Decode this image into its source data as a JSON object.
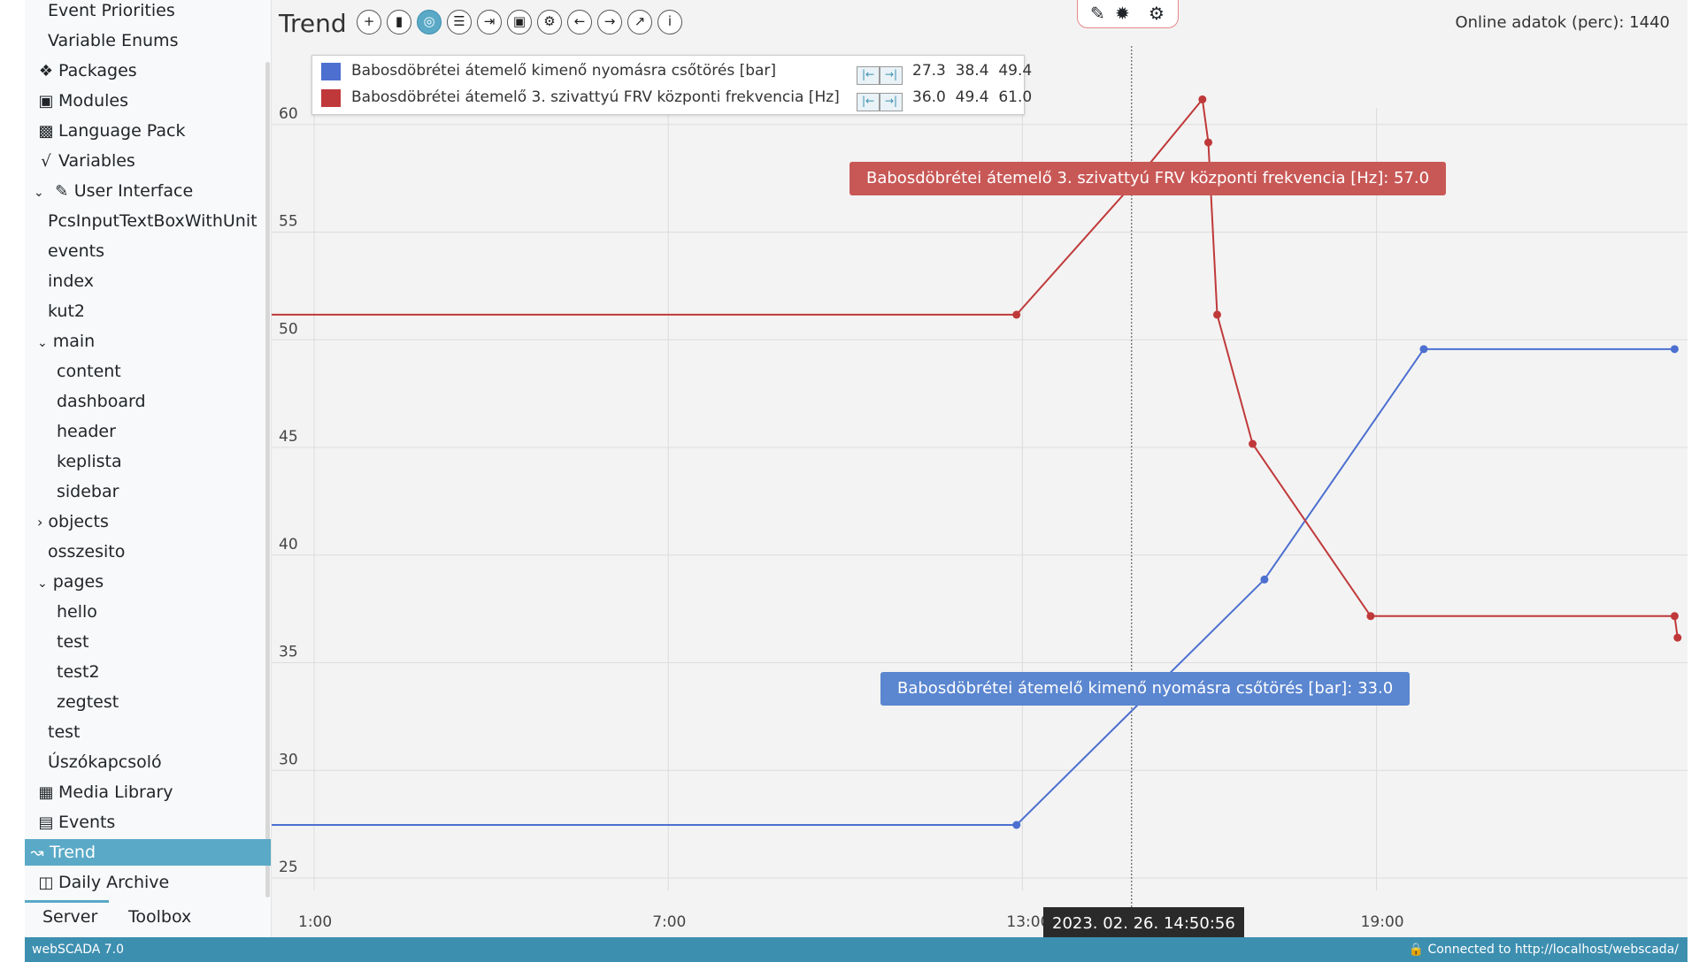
{
  "sidebar": {
    "items": [
      {
        "label": "Event Priorities",
        "icon": ""
      },
      {
        "label": "Variable Enums",
        "icon": ""
      },
      {
        "label": "Packages",
        "icon": "cubes-icon"
      },
      {
        "label": "Modules",
        "icon": "chip-icon"
      },
      {
        "label": "Language Pack",
        "icon": "language-icon"
      },
      {
        "label": "Variables",
        "icon": "sqrt-icon"
      },
      {
        "label": "User Interface",
        "icon": "edit-icon"
      },
      {
        "label": "PcsInputTextBoxWithUnit",
        "icon": ""
      },
      {
        "label": "events",
        "icon": ""
      },
      {
        "label": "index",
        "icon": ""
      },
      {
        "label": "kut2",
        "icon": ""
      },
      {
        "label": "main",
        "icon": ""
      },
      {
        "label": "content",
        "icon": ""
      },
      {
        "label": "dashboard",
        "icon": ""
      },
      {
        "label": "header",
        "icon": ""
      },
      {
        "label": "keplista",
        "icon": ""
      },
      {
        "label": "sidebar",
        "icon": ""
      },
      {
        "label": "objects",
        "icon": ""
      },
      {
        "label": "osszesito",
        "icon": ""
      },
      {
        "label": "pages",
        "icon": ""
      },
      {
        "label": "hello",
        "icon": ""
      },
      {
        "label": "test",
        "icon": ""
      },
      {
        "label": "test2",
        "icon": ""
      },
      {
        "label": "zegtest",
        "icon": ""
      },
      {
        "label": "test",
        "icon": ""
      },
      {
        "label": "Úszókapcsoló",
        "icon": ""
      },
      {
        "label": "Media Library",
        "icon": "book-icon"
      },
      {
        "label": "Events",
        "icon": "list-icon"
      },
      {
        "label": "Trend",
        "icon": "chart-icon"
      },
      {
        "label": "Daily Archive",
        "icon": "archive-icon"
      }
    ],
    "tabs": {
      "server": "Server",
      "toolbox": "Toolbox"
    }
  },
  "header": {
    "title": "Trend",
    "toolbar_icons": [
      "plus-icon",
      "file-icon",
      "globe-icon",
      "database-icon",
      "export-icon",
      "save-icon",
      "gear-icon",
      "arrow-left-icon",
      "arrow-right-icon",
      "expand-icon",
      "info-icon"
    ],
    "mode_icons": [
      "edit-icon",
      "bug-icon",
      "gear-icon"
    ],
    "online": "Online adatok (perc): 1440"
  },
  "legend": [
    {
      "name": "Babosdöbrétei átemelő kimenő nyomásra csőtörés [bar]",
      "color": "#4c6fd0",
      "min": "27.3",
      "avg": "38.4",
      "max": "49.4"
    },
    {
      "name": "Babosdöbrétei átemelő 3. szivattyú FRV központi frekvencia [Hz]",
      "color": "#c0393a",
      "min": "36.0",
      "avg": "49.4",
      "max": "61.0"
    }
  ],
  "tooltips": {
    "red": "Babosdöbrétei átemelő 3. szivattyú FRV központi frekvencia [Hz]: 57.0",
    "blue": "Babosdöbrétei átemelő kimenő nyomásra csőtörés [bar]: 33.0"
  },
  "cursor_time": "2023. 02. 26. 14:50:56",
  "status": {
    "version": "webSCADA 7.0",
    "connection": "Connected to http://localhost/webscada/"
  },
  "chart_data": {
    "type": "line",
    "yticks": [
      "25",
      "30",
      "35",
      "40",
      "45",
      "50",
      "55",
      "60"
    ],
    "xticks": [
      "1:00",
      "7:00",
      "13:00",
      "19:00"
    ],
    "ylim": [
      24,
      62
    ],
    "cursor_hours": 14.85,
    "series": [
      {
        "name": "Babosdöbrétei átemelő kimenő nyomásra csőtörés [bar]",
        "color": "#4c6fd0",
        "points": [
          [
            0.3,
            27.3
          ],
          [
            12.9,
            27.3
          ],
          [
            17.1,
            38.7
          ],
          [
            19.8,
            49.4
          ],
          [
            24.05,
            49.4
          ]
        ],
        "tail": [
          25.9,
          27.3
        ]
      },
      {
        "name": "Babosdöbrétei átemelő 3. szivattyú FRV központi frekvencia [Hz]",
        "color": "#c0393a",
        "points": [
          [
            0.3,
            51.0
          ],
          [
            12.9,
            51.0
          ],
          [
            14.85,
            57.0
          ],
          [
            16.05,
            61.0
          ],
          [
            16.15,
            59.0
          ],
          [
            16.3,
            51.0
          ],
          [
            16.9,
            45.0
          ],
          [
            18.9,
            37.0
          ],
          [
            24.05,
            37.0
          ],
          [
            24.1,
            36.0
          ]
        ],
        "tail": [
          25.9,
          51.0
        ]
      }
    ]
  }
}
